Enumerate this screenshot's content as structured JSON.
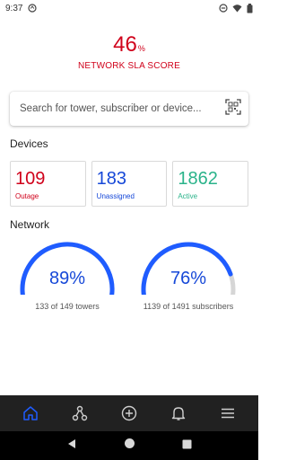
{
  "status_bar": {
    "time": "9:37"
  },
  "sla": {
    "score": "46",
    "unit": "%",
    "label": "NETWORK SLA SCORE",
    "color": "#d0021b"
  },
  "search": {
    "placeholder": "Search for tower, subscriber or device..."
  },
  "devices": {
    "title": "Devices",
    "cards": [
      {
        "value": "109",
        "label": "Outage",
        "color": "#d0021b"
      },
      {
        "value": "183",
        "label": "Unassigned",
        "color": "#1648d8"
      },
      {
        "value": "1862",
        "label": "Active",
        "color": "#2ab38a"
      }
    ]
  },
  "network": {
    "title": "Network",
    "gauges": [
      {
        "percent_text": "89%",
        "fraction": 0.89,
        "caption": "133 of 149 towers"
      },
      {
        "percent_text": "76%",
        "fraction": 0.76,
        "caption": "1139 of 1491 subscribers"
      }
    ]
  },
  "bottom_nav": {
    "items": [
      {
        "icon": "home-icon",
        "active": true
      },
      {
        "icon": "network-icon",
        "active": false
      },
      {
        "icon": "add-circle-icon",
        "active": false
      },
      {
        "icon": "bell-icon",
        "active": false
      },
      {
        "icon": "menu-icon",
        "active": false
      }
    ],
    "active_color": "#1f5cff",
    "inactive_color": "#cfcfcf"
  },
  "system_nav": {
    "icons": [
      "back-icon",
      "home-circle-icon",
      "recents-icon"
    ]
  }
}
